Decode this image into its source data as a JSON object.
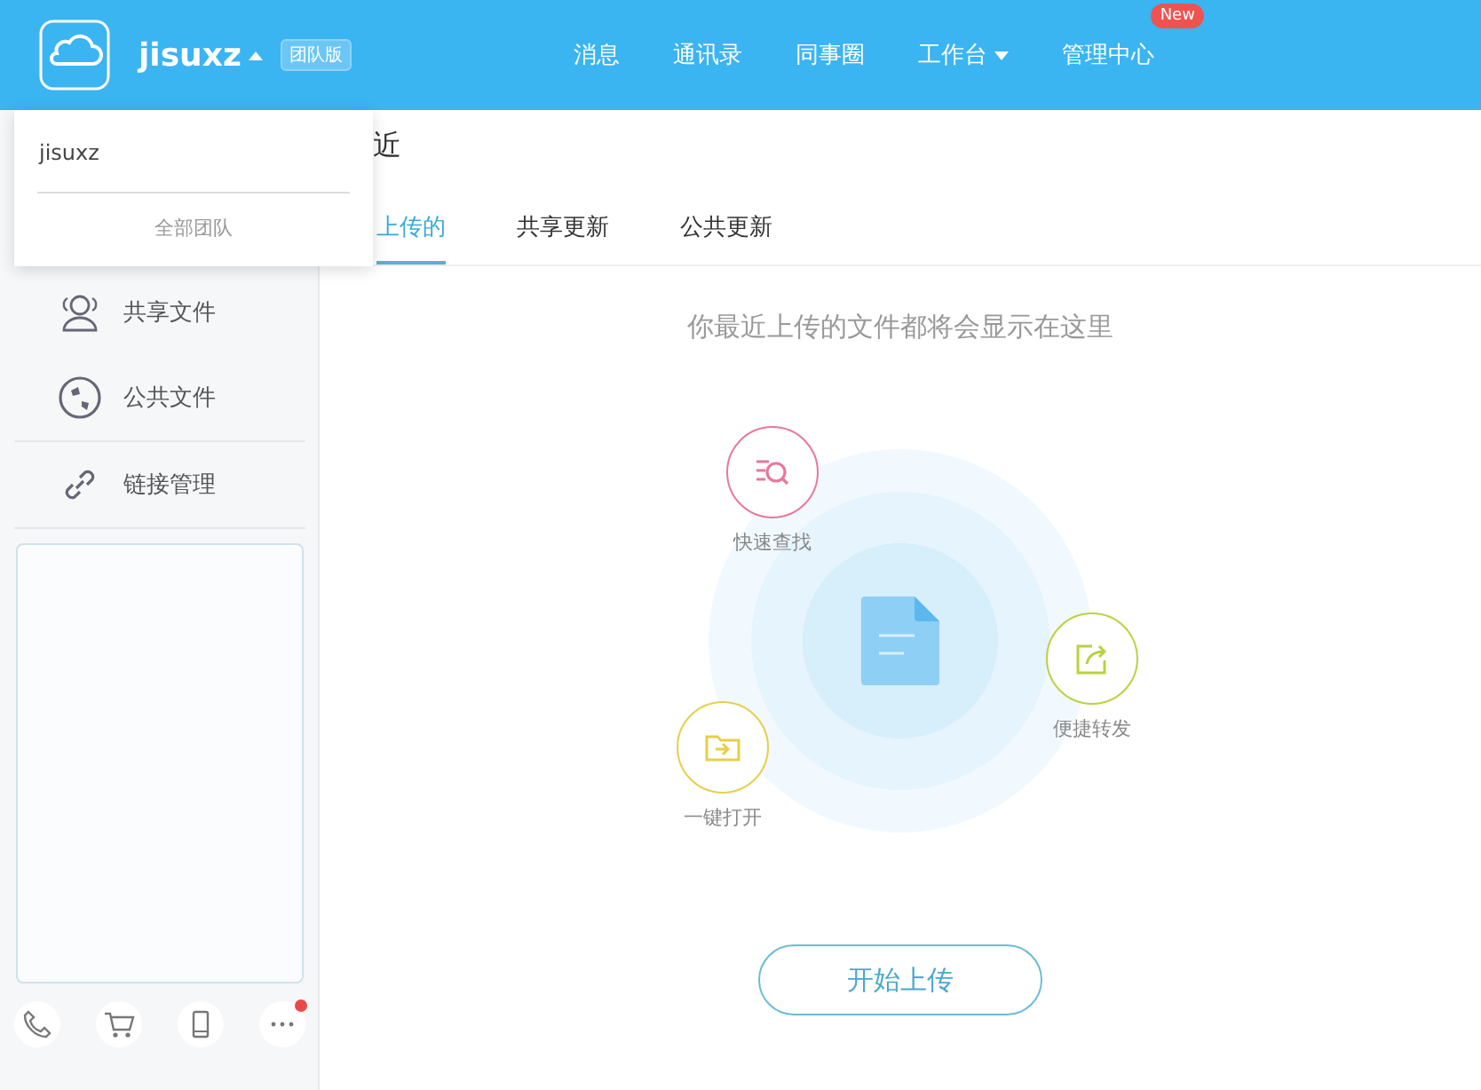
{
  "header": {
    "account": "jisuxz",
    "edition": "团队版",
    "nav": [
      {
        "label": "消息",
        "dropdown": false
      },
      {
        "label": "通讯录",
        "dropdown": false
      },
      {
        "label": "同事圈",
        "dropdown": false
      },
      {
        "label": "工作台",
        "dropdown": true
      },
      {
        "label": "管理中心",
        "dropdown": false,
        "badge": "New"
      }
    ]
  },
  "account_menu": {
    "items": [
      "jisuxz"
    ],
    "footer": "全部团队"
  },
  "sidebar": {
    "items": [
      {
        "label": "共享文件"
      },
      {
        "label": "公共文件"
      },
      {
        "label": "链接管理"
      }
    ],
    "tools": [
      {
        "dot": false
      },
      {
        "dot": false
      },
      {
        "dot": false
      },
      {
        "dot": true
      }
    ]
  },
  "content": {
    "title": "近",
    "tabs": [
      {
        "label": "上传的",
        "selected": true
      },
      {
        "label": "共享更新",
        "selected": false
      },
      {
        "label": "公共更新",
        "selected": false
      }
    ],
    "empty_message": "你最近上传的文件都将会显示在这里",
    "features": [
      {
        "label": "快速查找",
        "color": "#e8789a"
      },
      {
        "label": "一键打开",
        "color": "#e6cf4a"
      },
      {
        "label": "便捷转发",
        "color": "#b9d33c"
      }
    ],
    "upload_button": "开始上传"
  }
}
